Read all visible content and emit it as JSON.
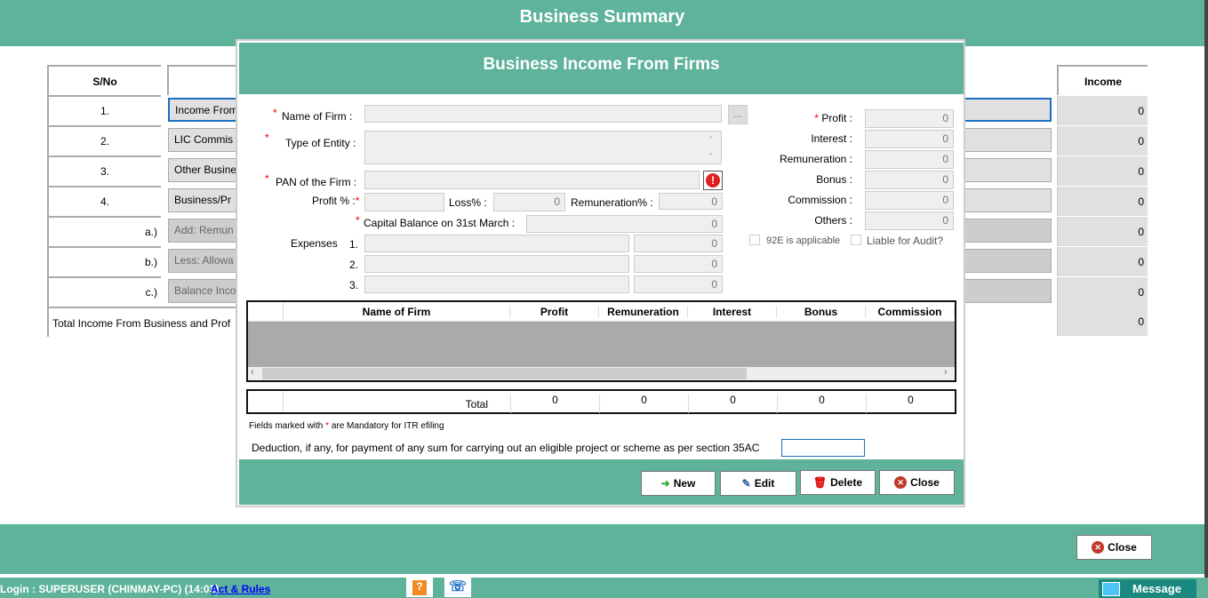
{
  "app": {
    "title": "Business Summary"
  },
  "summary": {
    "headers": {
      "sno": "S/No",
      "income": "Income"
    },
    "rows": [
      {
        "sno": "1.",
        "label": "Income From",
        "value": "0",
        "disabled": false,
        "focused": true
      },
      {
        "sno": "2.",
        "label": "LIC Commis",
        "value": "0",
        "disabled": false
      },
      {
        "sno": "3.",
        "label": "Other Busine",
        "value": "0",
        "disabled": false
      },
      {
        "sno": "4.",
        "label": "Business/Pr",
        "value": "0",
        "disabled": false
      },
      {
        "sno": "a.)",
        "label": "Add: Remun",
        "value": "0",
        "disabled": true
      },
      {
        "sno": "b.)",
        "label": "Less: Allowa",
        "value": "0",
        "disabled": true
      },
      {
        "sno": "c.)",
        "label": "Balance Inco",
        "value": "0",
        "disabled": true
      }
    ],
    "total_label": "Total Income From Business and Prof",
    "total_value": "0"
  },
  "dialog": {
    "title": "Business Income From Firms",
    "name_of_firm": {
      "label": "Name of Firm  :",
      "value": "",
      "browse": "..."
    },
    "type_of_entity": {
      "label": "Type of Entity  :",
      "value": ""
    },
    "pan": {
      "label": "PAN of the Firm :",
      "value": ""
    },
    "profit_pct": {
      "label": "Profit % :",
      "value": ""
    },
    "loss_pct": {
      "label": "Loss% :",
      "value": "0"
    },
    "remuneration_pct": {
      "label": "Remuneration% :",
      "value": "0"
    },
    "capital_balance": {
      "label": "Capital Balance on 31st March :",
      "value": "0"
    },
    "expenses": {
      "label": "Expenses",
      "items": [
        {
          "no": "1.",
          "desc": "",
          "value": "0"
        },
        {
          "no": "2.",
          "desc": "",
          "value": "0"
        },
        {
          "no": "3.",
          "desc": "",
          "value": "0"
        }
      ]
    },
    "right_fields": [
      {
        "label": "Profit :",
        "value": "0",
        "required": true
      },
      {
        "label": "Interest :",
        "value": "0"
      },
      {
        "label": "Remuneration :",
        "value": "0"
      },
      {
        "label": "Bonus :",
        "value": "0"
      },
      {
        "label": "Commission :",
        "value": "0"
      },
      {
        "label": "Others :",
        "value": "0"
      }
    ],
    "checkboxes": {
      "s92e": "92E is applicable",
      "audit": "Liable for Audit?"
    },
    "grid": {
      "columns": [
        "Name of Firm",
        "Profit",
        "Remuneration",
        "Interest",
        "Bonus",
        "Commission"
      ]
    },
    "totals": {
      "label": "Total",
      "values": [
        "0",
        "0",
        "0",
        "0",
        "0"
      ]
    },
    "mandatory_note": {
      "before": "Fields marked with",
      "star": "*",
      "after": "are Mandatory for ITR efiling"
    },
    "deduction": {
      "label": "Deduction, if any, for payment of any sum for carrying out an eligible project or scheme as per section 35AC",
      "value": ""
    },
    "buttons": {
      "new": "New",
      "edit": "Edit",
      "delete": "Delete",
      "close": "Close"
    }
  },
  "footer": {
    "close": "Close"
  },
  "status": {
    "login": "Login : SUPERUSER (CHINMAY-PC) (14:03)",
    "act_rules": "Act & Rules",
    "message": "Message"
  },
  "colors": {
    "teal": "#5eb39a",
    "required": "#e00000"
  }
}
